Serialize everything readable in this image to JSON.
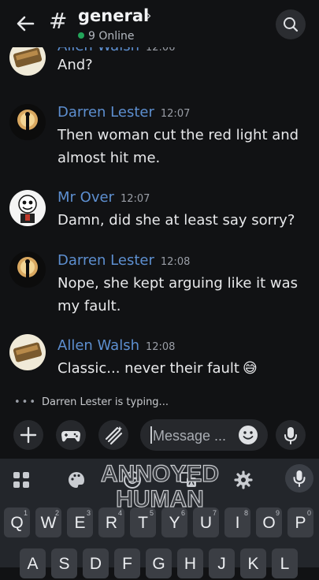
{
  "header": {
    "channel_symbol": "#",
    "channel_name": "general",
    "online_text": "9 Online"
  },
  "messages": [
    {
      "author": "Allen Walsh",
      "time": "12:06",
      "text": "And?",
      "author_color": "#5d8fd0"
    },
    {
      "author": "Darren Lester",
      "time": "12:07",
      "text": "Then woman cut the red light and almost hit me.",
      "author_color": "#5d8fd0"
    },
    {
      "author": "Mr Over",
      "time": "12:07",
      "text": "Damn, did she at least say sorry?",
      "author_color": "#5d8fd0"
    },
    {
      "author": "Darren Lester",
      "time": "12:08",
      "text": "Nope, she kept arguing like it was my fault.",
      "author_color": "#5d8fd0"
    },
    {
      "author": "Allen Walsh",
      "time": "12:08",
      "text": "Classic... never their fault",
      "emoji": "😅",
      "author_color": "#5d8fd0"
    }
  ],
  "typing_indicator": "Darren Lester is typing...",
  "composer": {
    "placeholder": "Message ..."
  },
  "keyboard": {
    "row1": [
      {
        "key": "Q",
        "num": "1"
      },
      {
        "key": "W",
        "num": "2"
      },
      {
        "key": "E",
        "num": "3"
      },
      {
        "key": "R",
        "num": "4"
      },
      {
        "key": "T",
        "num": "5"
      },
      {
        "key": "Y",
        "num": "6"
      },
      {
        "key": "U",
        "num": "7"
      },
      {
        "key": "I",
        "num": "8"
      },
      {
        "key": "O",
        "num": "9"
      },
      {
        "key": "P",
        "num": "0"
      }
    ],
    "row2": [
      "A",
      "S",
      "D",
      "F",
      "G",
      "H",
      "J",
      "K",
      "L"
    ]
  },
  "overlay_caption": "ANNOYED HUMAN",
  "colors": {
    "background": "#111214",
    "author_name": "#5d8fd0",
    "online_dot": "#23a55a",
    "keyboard_bg": "#23262b",
    "key_bg": "#3b3e44"
  }
}
